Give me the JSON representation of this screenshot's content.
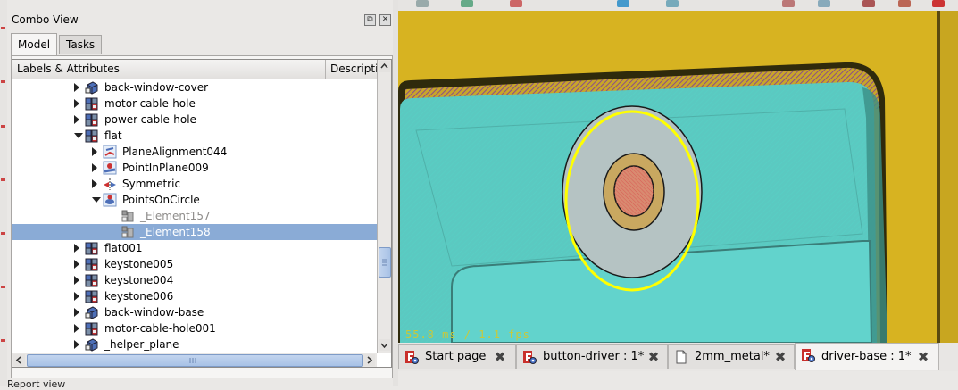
{
  "combo_view": {
    "title": "Combo View",
    "tabs": [
      "Model",
      "Tasks"
    ],
    "active_tab": "Model"
  },
  "tree": {
    "columns": [
      "Labels & Attributes",
      "Description"
    ],
    "items": [
      {
        "label": "back-window-cover",
        "depth": 0,
        "expander": "collapsed",
        "icon": "part-body-icon",
        "selected": false,
        "dimmed": false
      },
      {
        "label": "motor-cable-hole",
        "depth": 0,
        "expander": "collapsed",
        "icon": "assembly-icon",
        "selected": false,
        "dimmed": false
      },
      {
        "label": "power-cable-hole",
        "depth": 0,
        "expander": "collapsed",
        "icon": "assembly-icon",
        "selected": false,
        "dimmed": false
      },
      {
        "label": "flat",
        "depth": 0,
        "expander": "expanded",
        "icon": "assembly-icon",
        "selected": false,
        "dimmed": false
      },
      {
        "label": "PlaneAlignment044",
        "depth": 1,
        "expander": "collapsed",
        "icon": "constraint-plane-alignment-icon",
        "selected": false,
        "dimmed": false
      },
      {
        "label": "PointInPlane009",
        "depth": 1,
        "expander": "collapsed",
        "icon": "constraint-point-in-plane-icon",
        "selected": false,
        "dimmed": false
      },
      {
        "label": "Symmetric",
        "depth": 1,
        "expander": "collapsed",
        "icon": "constraint-symmetric-icon",
        "selected": false,
        "dimmed": false
      },
      {
        "label": "PointsOnCircle",
        "depth": 1,
        "expander": "expanded",
        "icon": "constraint-points-on-circle-icon",
        "selected": false,
        "dimmed": false
      },
      {
        "label": "_Element157",
        "depth": 2,
        "expander": "none",
        "icon": "element-link-icon",
        "selected": false,
        "dimmed": true
      },
      {
        "label": "_Element158",
        "depth": 2,
        "expander": "none",
        "icon": "element-link-icon",
        "selected": true,
        "dimmed": false
      },
      {
        "label": "flat001",
        "depth": 0,
        "expander": "collapsed",
        "icon": "assembly-icon",
        "selected": false,
        "dimmed": false
      },
      {
        "label": "keystone005",
        "depth": 0,
        "expander": "collapsed",
        "icon": "assembly-icon",
        "selected": false,
        "dimmed": false
      },
      {
        "label": "keystone004",
        "depth": 0,
        "expander": "collapsed",
        "icon": "assembly-icon",
        "selected": false,
        "dimmed": false
      },
      {
        "label": "keystone006",
        "depth": 0,
        "expander": "collapsed",
        "icon": "assembly-icon",
        "selected": false,
        "dimmed": false
      },
      {
        "label": "back-window-base",
        "depth": 0,
        "expander": "collapsed",
        "icon": "part-body-icon",
        "selected": false,
        "dimmed": false
      },
      {
        "label": "motor-cable-hole001",
        "depth": 0,
        "expander": "collapsed",
        "icon": "assembly-icon",
        "selected": false,
        "dimmed": false
      },
      {
        "label": "_helper_plane",
        "depth": 0,
        "expander": "collapsed",
        "icon": "part-body-icon",
        "selected": false,
        "dimmed": false
      }
    ]
  },
  "viewport": {
    "fps_text": "55.8 ms / 1.1 fps"
  },
  "document_tabs": [
    {
      "label": "Start page",
      "icon": "freecad-doc-icon",
      "active": false
    },
    {
      "label": "button-driver : 1*",
      "icon": "freecad-doc-icon",
      "active": false
    },
    {
      "label": "2mm_metal*",
      "icon": "blank-doc-icon",
      "active": false
    },
    {
      "label": "driver-base : 1*",
      "icon": "freecad-doc-icon",
      "active": true
    }
  ],
  "bottom": {
    "report_view": "Report view"
  },
  "colors": {
    "selection": "#8aabd6",
    "viewport_background": "#d7b321",
    "fps_text": "#c9c93a",
    "highlight_ring": "#ffff00"
  }
}
